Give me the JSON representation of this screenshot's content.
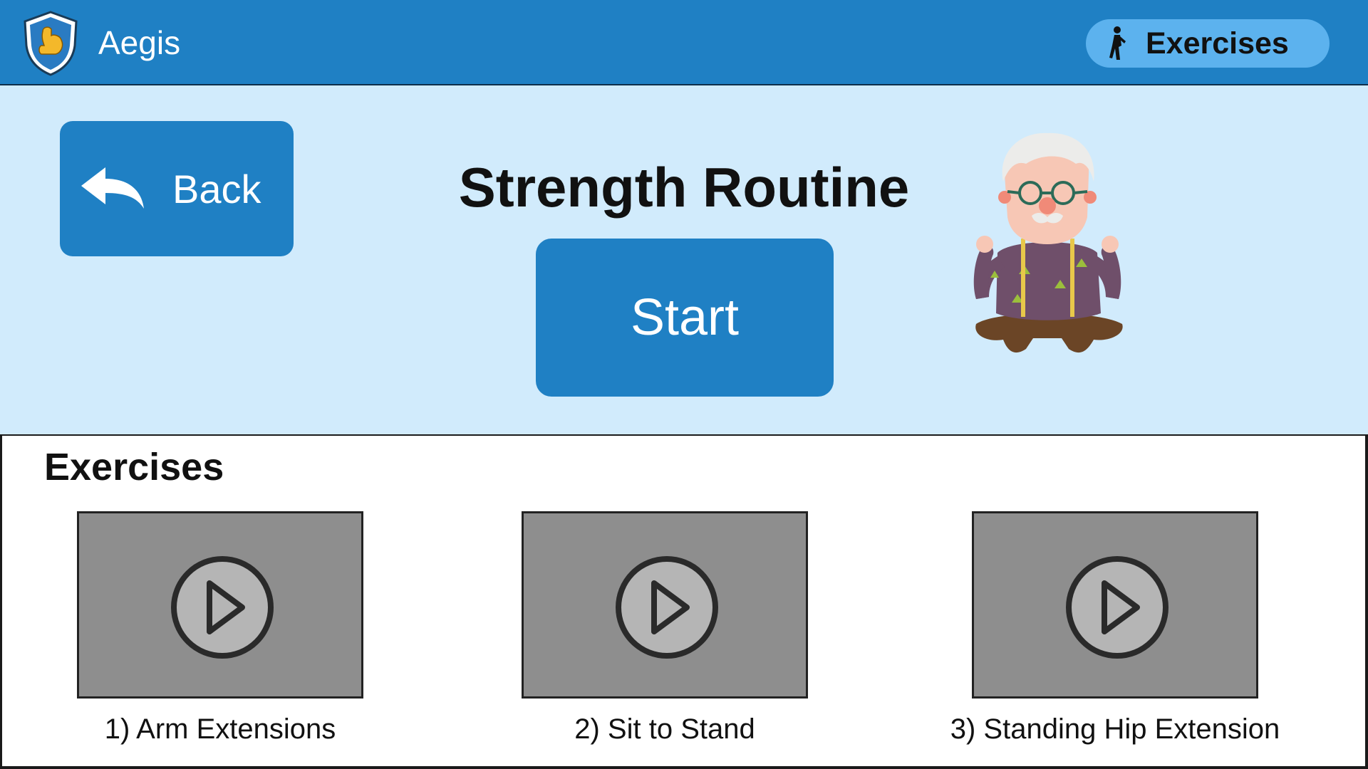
{
  "app": {
    "name": "Aegis",
    "logo_icon": "shield-flexed-biceps-icon"
  },
  "nav": {
    "label": "Exercises",
    "icon": "person-exercise-icon"
  },
  "hero": {
    "back_label": "Back",
    "back_icon": "reply-arrow-icon",
    "title": "Strength Routine",
    "start_label": "Start",
    "illustration": "elderly-man-flexing-illustration"
  },
  "exercises": {
    "heading": "Exercises",
    "items": [
      {
        "caption": "1) Arm Extensions",
        "icon": "play-icon"
      },
      {
        "caption": "2) Sit to Stand",
        "icon": "play-icon"
      },
      {
        "caption": "3) Standing Hip Extension",
        "icon": "play-icon"
      }
    ]
  },
  "colors": {
    "header_bg": "#1f80c4",
    "hero_bg": "#d1ebfc",
    "nav_pill": "#5cb2ee",
    "button_bg": "#1f80c4",
    "thumb_bg": "#8e8e8e"
  }
}
